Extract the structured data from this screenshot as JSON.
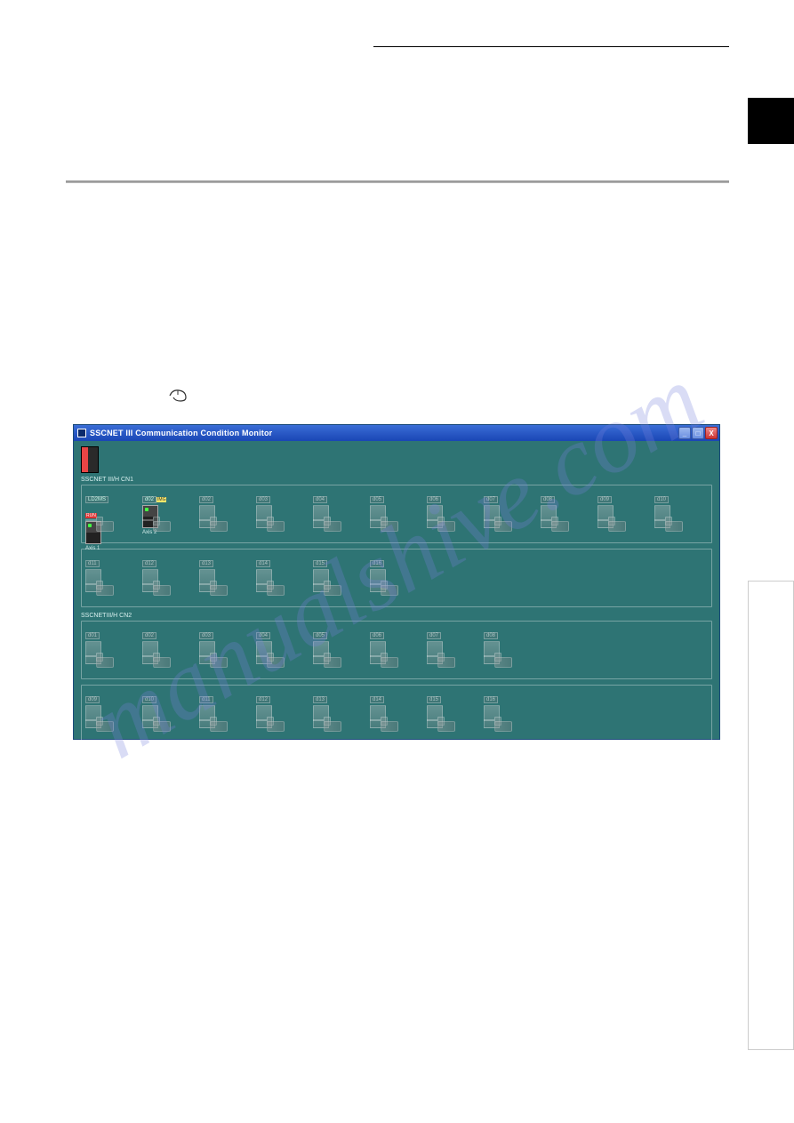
{
  "window": {
    "title": "SSCNET III Communication Condition Monitor",
    "min_label": "_",
    "max_label": "□",
    "close_label": "X"
  },
  "cpu_label": "",
  "networks": [
    {
      "label": "SSCNET III/H CN1",
      "rows": [
        {
          "slots": [
            {
              "d": "",
              "axis": "Axis 1",
              "badge": "RUN",
              "badge_type": "run",
              "active": true,
              "has_axis": true,
              "sub": "LD2MS"
            },
            {
              "d": "",
              "axis": "Axis 2",
              "badge": "IMG",
              "badge_type": "",
              "active": true,
              "has_axis": true,
              "sub": "d02"
            },
            {
              "d": "d02",
              "axis": "",
              "active": false
            },
            {
              "d": "d03",
              "axis": "",
              "active": false
            },
            {
              "d": "d04",
              "axis": "",
              "active": false
            },
            {
              "d": "d05",
              "axis": "",
              "active": false
            },
            {
              "d": "d06",
              "axis": "",
              "active": false
            },
            {
              "d": "d07",
              "axis": "",
              "active": false
            },
            {
              "d": "d08",
              "axis": "",
              "active": false
            },
            {
              "d": "d09",
              "axis": "",
              "active": false
            },
            {
              "d": "d10",
              "axis": "",
              "active": false
            }
          ]
        },
        {
          "slots": [
            {
              "d": "d11",
              "active": false
            },
            {
              "d": "d12",
              "active": false
            },
            {
              "d": "d13",
              "active": false
            },
            {
              "d": "d14",
              "active": false
            },
            {
              "d": "d15",
              "active": false
            },
            {
              "d": "d16",
              "active": false
            }
          ]
        }
      ]
    },
    {
      "label": "SSCNETIII/H CN2",
      "rows": [
        {
          "slots": [
            {
              "d": "d01",
              "active": false
            },
            {
              "d": "d02",
              "active": false
            },
            {
              "d": "d03",
              "active": false
            },
            {
              "d": "d04",
              "active": false
            },
            {
              "d": "d05",
              "active": false
            },
            {
              "d": "d06",
              "active": false
            },
            {
              "d": "d07",
              "active": false
            },
            {
              "d": "d08",
              "active": false
            }
          ]
        },
        {
          "slots": [
            {
              "d": "d09",
              "active": false
            },
            {
              "d": "d10",
              "active": false
            },
            {
              "d": "d11",
              "active": false
            },
            {
              "d": "d12",
              "active": false
            },
            {
              "d": "d13",
              "active": false
            },
            {
              "d": "d14",
              "active": false
            },
            {
              "d": "d15",
              "active": false
            },
            {
              "d": "d16",
              "active": false
            }
          ]
        }
      ]
    }
  ],
  "watermark": "manualshive.com"
}
